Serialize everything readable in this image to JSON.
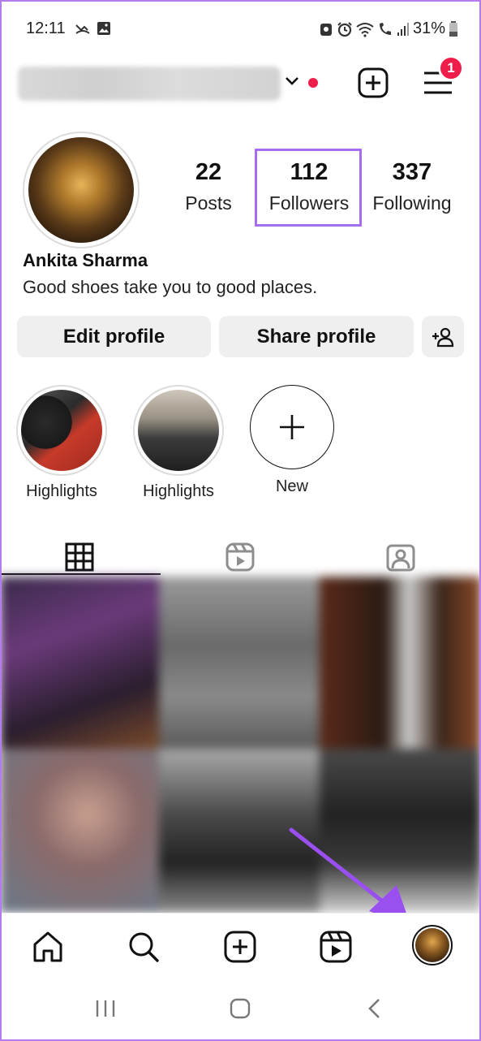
{
  "status_bar": {
    "time": "12:11",
    "battery": "31%"
  },
  "header": {
    "username_hidden": true,
    "notification_count": "1"
  },
  "profile": {
    "stats": [
      {
        "value": "22",
        "label": "Posts"
      },
      {
        "value": "112",
        "label": "Followers"
      },
      {
        "value": "337",
        "label": "Following"
      }
    ],
    "name": "Ankita Sharma",
    "bio": "Good shoes take you to good places."
  },
  "buttons": {
    "edit_profile": "Edit profile",
    "share_profile": "Share profile"
  },
  "highlights": [
    {
      "label": "Highlights"
    },
    {
      "label": "Highlights"
    },
    {
      "label": "New"
    }
  ],
  "tabs": [
    "grid-icon",
    "reels-icon",
    "tagged-icon"
  ],
  "bottom_nav": [
    "home-icon",
    "search-icon",
    "create-icon",
    "reels-icon",
    "profile-avatar"
  ],
  "colors": {
    "accent_highlight": "#a56ef0",
    "notification_red": "#ee1d4a",
    "button_bg": "#efefef"
  }
}
